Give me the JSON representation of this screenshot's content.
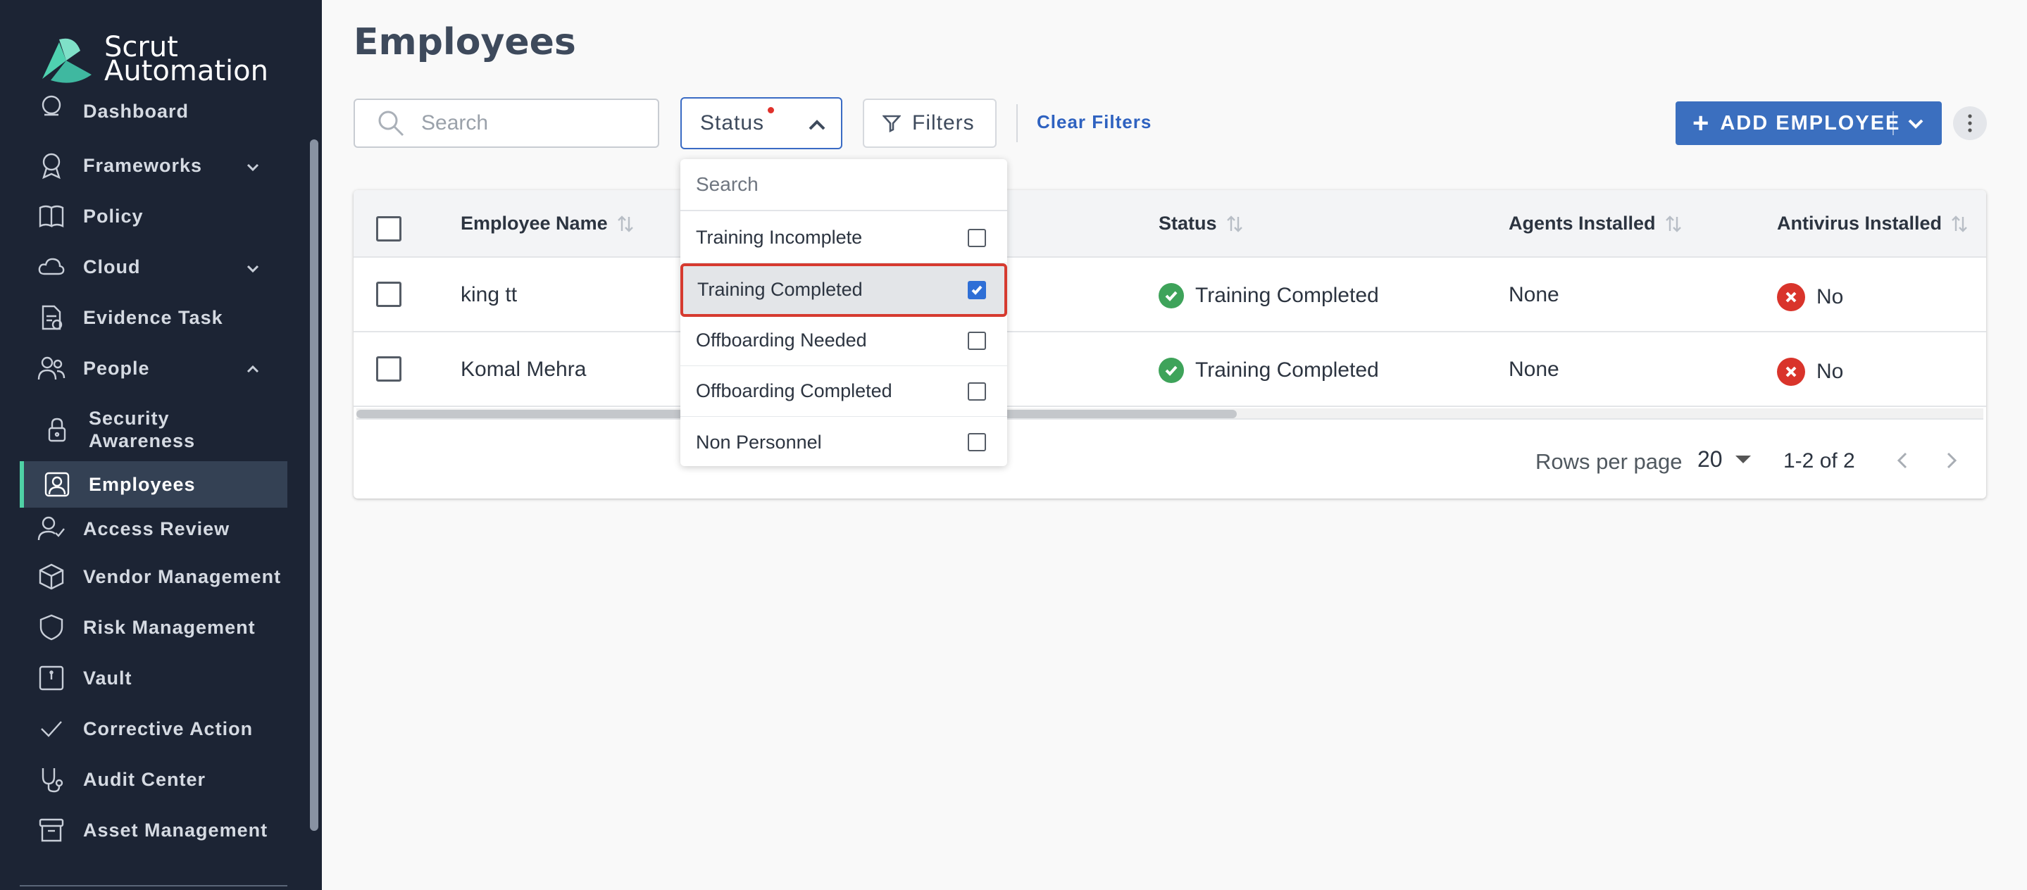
{
  "brand": {
    "line1": "Scrut",
    "line2": "Automation"
  },
  "sidebar": {
    "items": [
      {
        "label": "Dashboard",
        "icon": "dashboard-icon"
      },
      {
        "label": "Frameworks",
        "icon": "award-icon",
        "expand": "chevron-down-icon"
      },
      {
        "label": "Policy",
        "icon": "book-icon"
      },
      {
        "label": "Cloud",
        "icon": "cloud-icon",
        "expand": "chevron-down-icon"
      },
      {
        "label": "Evidence Task",
        "icon": "document-check-icon"
      },
      {
        "label": "People",
        "icon": "users-icon",
        "expand": "chevron-up-icon"
      },
      {
        "label": "Security Awareness",
        "icon": "lock-icon",
        "sub": true
      },
      {
        "label": "Employees",
        "icon": "user-badge-icon",
        "sub": true,
        "active": true
      },
      {
        "label": "Access Review",
        "icon": "user-check-icon"
      },
      {
        "label": "Vendor Management",
        "icon": "box-icon"
      },
      {
        "label": "Risk Management",
        "icon": "shield-icon"
      },
      {
        "label": "Vault",
        "icon": "vault-icon"
      },
      {
        "label": "Corrective Action",
        "icon": "check-icon"
      },
      {
        "label": "Audit Center",
        "icon": "stethoscope-icon"
      },
      {
        "label": "Asset Management",
        "icon": "archive-icon"
      }
    ]
  },
  "page": {
    "title": "Employees"
  },
  "toolbar": {
    "search_placeholder": "Search",
    "status_label": "Status",
    "filters_label": "Filters",
    "clear_filters_label": "Clear Filters",
    "add_employee_label": "ADD EMPLOYEE",
    "add_icon": "+"
  },
  "status_dropdown": {
    "search_placeholder": "Search",
    "options": [
      {
        "label": "Training Incomplete",
        "checked": false
      },
      {
        "label": "Training Completed",
        "checked": true
      },
      {
        "label": "Offboarding Needed",
        "checked": false
      },
      {
        "label": "Offboarding Completed",
        "checked": false
      },
      {
        "label": "Non Personnel",
        "checked": false
      }
    ]
  },
  "table": {
    "columns": [
      "Employee Name",
      "Status",
      "Agents Installed",
      "Antivirus Installed"
    ],
    "rows": [
      {
        "name": "king tt",
        "status": "Training Completed",
        "agents": "None",
        "antivirus": "No"
      },
      {
        "name": "Komal Mehra",
        "status": "Training Completed",
        "agents": "None",
        "antivirus": "No"
      }
    ]
  },
  "pagination": {
    "rows_per_page_label": "Rows per page",
    "rows_per_page_value": "20",
    "range": "1-2 of 2"
  },
  "colors": {
    "sidebar_bg": "#1c2434",
    "accent": "#3b6fbf",
    "success": "#3ea35a",
    "danger": "#d9342b",
    "highlight_outline": "#d63a2f"
  }
}
